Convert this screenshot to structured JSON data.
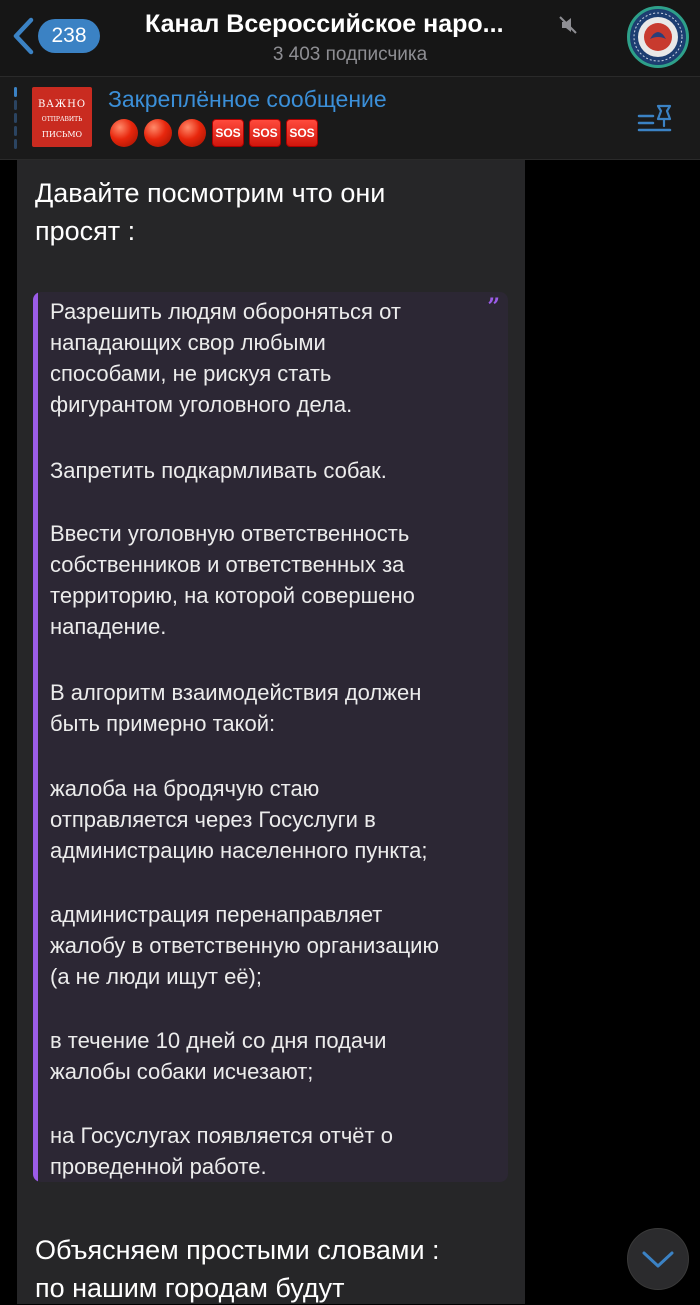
{
  "header": {
    "back_count": "238",
    "title": "Канал Всероссийское наро...",
    "subtitle": "3 403 подписчика"
  },
  "pinned": {
    "label": "Закреплённое сообщение",
    "thumb": {
      "line1": "ВАЖНО",
      "line2": "ОТПРАВИТЬ",
      "line3": "ПИСЬМО"
    },
    "sos_label": "SOS"
  },
  "message": {
    "intro_line1": "Давайте посмотрим что они",
    "intro_line2": "просят :",
    "quote": [
      [
        "Разрешить людям обороняться от",
        "нападающих свор любыми",
        "способами, не рискуя стать",
        "фигурантом уголовного дела."
      ],
      [
        "Запретить подкармливать собак."
      ],
      [
        "Ввести уголовную ответственность",
        "собственников и ответственных за",
        "территорию, на которой совершено",
        "нападение."
      ],
      [
        "В алгоритм взаимодействия должен",
        "быть примерно такой:"
      ],
      [
        "жалоба на бродячую стаю",
        "отправляется через Госуслуги в",
        "администрацию населенного пункта;"
      ],
      [
        "администрация перенаправляет",
        "жалобу в ответственную организацию",
        "(а не люди ищут её);"
      ],
      [
        "в течение 10 дней со дня подачи",
        "жалобы собаки исчезают;"
      ],
      [
        "на Госуслугах появляется отчёт о",
        "проведенной работе."
      ]
    ],
    "outro_line1": "Объясняем простыми словами :",
    "outro_line2": "по нашим городам будут"
  },
  "colors": {
    "accent": "#3b82c4",
    "quote_accent": "#9b5ce8",
    "header_bg": "#161616",
    "bubble_bg": "#262628"
  },
  "icons": {
    "back": "chevron-left-icon",
    "mute": "muted-speaker-icon",
    "pinned_list": "pinned-list-icon",
    "scroll": "chevron-down-icon",
    "quote": "quote-mark-icon"
  }
}
